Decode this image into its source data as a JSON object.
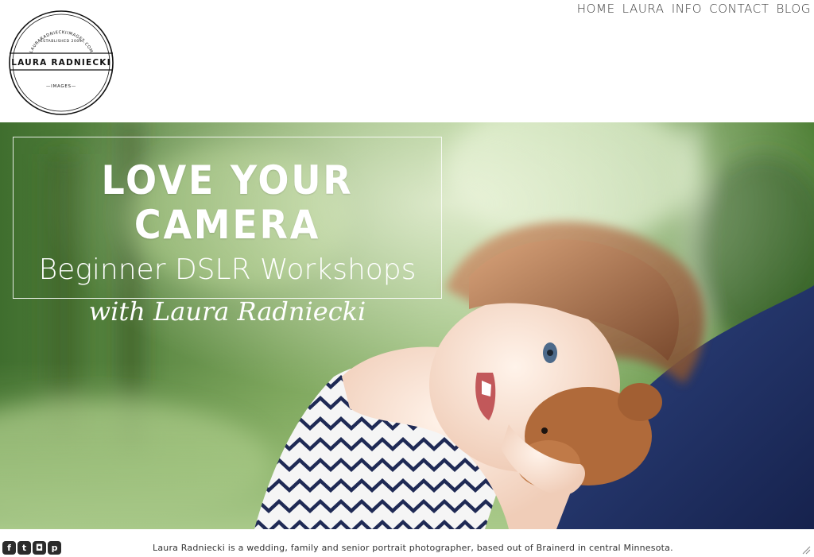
{
  "logo": {
    "name": "LAURA RADNIECKI",
    "ring_text": "LAURARADNIECKIIMAGES.COM",
    "established": "ESTABLISHED 2009",
    "subtitle": "—IMAGES—"
  },
  "nav": {
    "items": [
      {
        "label": "HOME"
      },
      {
        "label": "LAURA"
      },
      {
        "label": "INFO"
      },
      {
        "label": "CONTACT"
      },
      {
        "label": "BLOG"
      }
    ]
  },
  "hero": {
    "title": "LOVE YOUR CAMERA",
    "subtitle": "Beginner DSLR Workshops",
    "byline": "with Laura Radniecki"
  },
  "footer": {
    "social": [
      {
        "icon": "facebook-icon",
        "glyph": "f"
      },
      {
        "icon": "twitter-icon",
        "glyph": "t"
      },
      {
        "icon": "instagram-icon",
        "glyph": "◘"
      },
      {
        "icon": "pinterest-icon",
        "glyph": "p"
      }
    ],
    "tagline": "Laura Radniecki is a wedding, family and senior portrait photographer, based out of Brainerd in central Minnesota."
  },
  "colors": {
    "nav_text": "#3a3a3a",
    "hero_green": "#6f9a4d",
    "pillow_blue": "#1f2f63"
  }
}
